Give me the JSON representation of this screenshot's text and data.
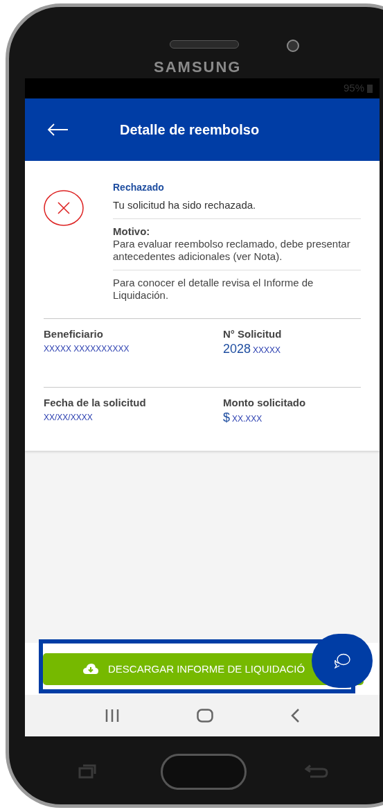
{
  "device": {
    "brand": "SAMSUNG"
  },
  "status_bar": {
    "battery": "95%"
  },
  "header": {
    "title": "Detalle de reembolso"
  },
  "status": {
    "label": "Rechazado",
    "message": "Tu solicitud ha sido rechazada.",
    "reason_label": "Motivo:",
    "reason": "Para evaluar reembolso reclamado, debe presentar antecedentes adicionales (ver Nota).",
    "note": "Para conocer el detalle revisa el Informe de Liquidación."
  },
  "fields": [
    {
      "label": "Beneficiario",
      "value": "XXXXX XXXXXXXXXX"
    },
    {
      "label": "N° Solicitud",
      "prefix": "2028",
      "value": "XXXXX"
    },
    {
      "label": "Fecha de la solicitud",
      "value": "XX/XX/XXXX"
    },
    {
      "label": "Monto solicitado",
      "prefix": "$",
      "value": "XX.XXX"
    }
  ],
  "download_button": {
    "label": "DESCARGAR INFORME DE LIQUIDACIÓ",
    "highlighted": true
  }
}
